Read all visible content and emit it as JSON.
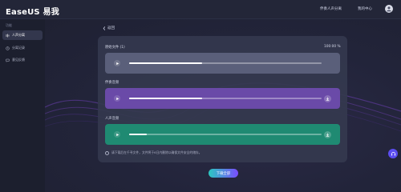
{
  "app": {
    "logo_text": "EaseUS 易我",
    "logo_mark": "✪"
  },
  "header": {
    "link_separate": "伴奏人声分离",
    "link_account": "我的中心"
  },
  "sidebar": {
    "heading": "功能",
    "items": [
      {
        "label": "人声分离",
        "icon": "music-separate-icon",
        "active": true
      },
      {
        "label": "分离记录",
        "icon": "history-icon",
        "active": false
      },
      {
        "label": "意见反馈",
        "icon": "feedback-icon",
        "active": false
      }
    ]
  },
  "main": {
    "back_label": "返回",
    "back_icon": "chevron-left-icon",
    "tracks": [
      {
        "label": "原始文件 (1)",
        "fill": 0.38,
        "color": "#5a5f7a",
        "downloadable": false
      },
      {
        "label": "伴奏音频",
        "fill": 0.38,
        "color": "#6a4aa8",
        "downloadable": true
      },
      {
        "label": "人声音频",
        "fill": 0.09,
        "color": "#1f8a72",
        "downloadable": true
      }
    ],
    "progress_text": "100:00 %",
    "note": "请下载后在千寻文件，文件将于6日内删除以确保文件安全的储存。",
    "download_label": "下载全部"
  },
  "colors": {
    "accent_start": "#2bc8c0",
    "accent_end": "#7a4cff",
    "help": "#5b4df0"
  }
}
